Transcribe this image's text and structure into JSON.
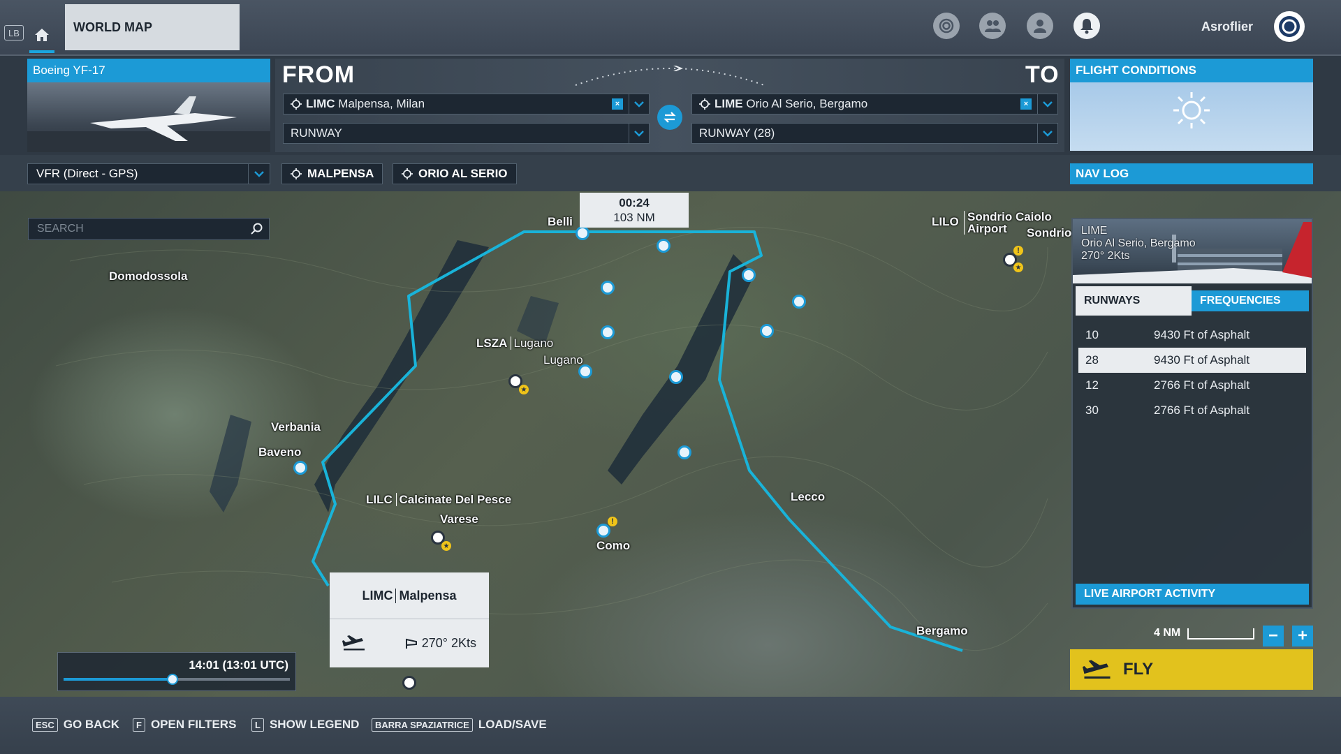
{
  "topbar": {
    "lb_key": "LB",
    "tab_title": "WORLD MAP",
    "username": "Asroflier"
  },
  "aircraft": {
    "name": "Boeing YF-17"
  },
  "route": {
    "from_label": "FROM",
    "to_label": "TO",
    "departure": {
      "code": "LIMC",
      "name": "Malpensa, Milan",
      "runway": "RUNWAY"
    },
    "arrival": {
      "code": "LIME",
      "name": "Orio Al Serio, Bergamo",
      "runway": "RUNWAY (28)"
    },
    "clear_label": "×"
  },
  "conditions": {
    "title": "FLIGHT CONDITIONS"
  },
  "flightplan": {
    "type": "VFR (Direct - GPS)",
    "chips": [
      "MALPENSA",
      "ORIO AL SERIO"
    ]
  },
  "navlog": {
    "title": "NAV LOG"
  },
  "map": {
    "search_placeholder": "SEARCH",
    "route_time": "00:24",
    "route_distance": "103 NM",
    "places": {
      "domodossola": "Domodossola",
      "verbania": "Verbania",
      "baveno": "Baveno",
      "bellinzona": "Belli",
      "lugano_code": "LSZA",
      "lugano_name": "Lugano",
      "lugano_town": "Lugano",
      "lilc_code": "LILC",
      "lilc_name": "Calcinate Del Pesce",
      "varese": "Varese",
      "como": "Como",
      "lecco": "Lecco",
      "bergamo": "Bergamo",
      "lilo_code": "LILO",
      "lilo_name_1": "Sondrio Caiolo",
      "lilo_name_2": "Airport",
      "sondrio": "Sondrio"
    },
    "scale_label": "4 NM",
    "zoom_out": "−",
    "zoom_in": "+"
  },
  "popup": {
    "code": "LIMC",
    "name": "Malpensa",
    "wind": "270° 2Kts"
  },
  "time": {
    "label": "14:01 (13:01 UTC)",
    "progress": 0.48
  },
  "airport_panel": {
    "code": "LIME",
    "name": "Orio Al Serio, Bergamo",
    "wind": "270° 2Kts",
    "tabs": {
      "runways": "RUNWAYS",
      "frequencies": "FREQUENCIES"
    },
    "runways": [
      {
        "number": "10",
        "surface": "9430 Ft of Asphalt",
        "selected": false
      },
      {
        "number": "28",
        "surface": "9430 Ft of Asphalt",
        "selected": true
      },
      {
        "number": "12",
        "surface": "2766 Ft of Asphalt",
        "selected": false
      },
      {
        "number": "30",
        "surface": "2766 Ft of Asphalt",
        "selected": false
      }
    ],
    "live_activity": "LIVE AIRPORT ACTIVITY"
  },
  "fly": {
    "label": "FLY"
  },
  "bottombar": [
    {
      "key": "ESC",
      "label": "GO BACK"
    },
    {
      "key": "F",
      "label": "OPEN FILTERS"
    },
    {
      "key": "L",
      "label": "SHOW LEGEND"
    },
    {
      "key": "BARRA SPAZIATRICE",
      "label": "LOAD/SAVE"
    }
  ],
  "colors": {
    "accent": "#1c9ad6",
    "route": "#19b3d9",
    "fly": "#e2c21d",
    "panel": "#1d2732"
  }
}
